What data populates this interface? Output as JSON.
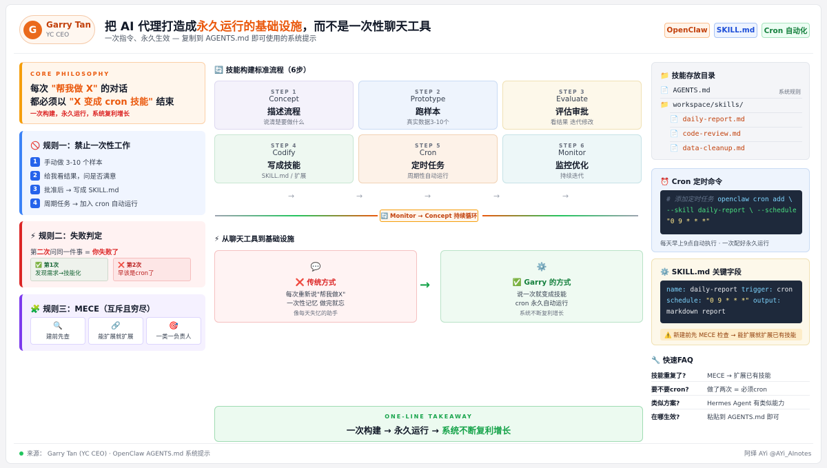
{
  "header": {
    "author": {
      "initial": "G",
      "name": "Garry Tan",
      "title": "YC CEO"
    },
    "headline_a": "把 AI 代理打造成",
    "headline_hl": "永久运行的基础设施",
    "headline_b": "，而不是一次性聊天工具",
    "subline": "一次指令、永久生效 — 复制到 AGENTS.md 即可使用的系统提示",
    "tags": [
      "OpenClaw",
      "SKILL.md",
      "Cron 自动化"
    ]
  },
  "philosophy": {
    "kicker": "CORE PHILOSOPHY",
    "l1_a": "每次 ",
    "l1_hl": "\"帮我做 X\"",
    "l1_b": " 的对话",
    "l2_a": "都必须以 ",
    "l2_hl": "\"X 变成 cron 技能\"",
    "l2_b": " 结束",
    "sub": "一次构建，永久运行，系统复利增长"
  },
  "rule1": {
    "icon": "🚫",
    "title": "规则一：禁止一次性工作",
    "steps": [
      {
        "n": "1",
        "text": "手动做 3-10 个样本"
      },
      {
        "n": "2",
        "text": "给我看结果，问是否满意"
      },
      {
        "n": "3",
        "text": "批准后 → 写成 SKILL.md"
      },
      {
        "n": "4",
        "text": "周期任务 → 加入 cron 自动运行"
      }
    ]
  },
  "rule2": {
    "icon": "⚡",
    "title": "规则二：失败判定",
    "desc_a": "第",
    "desc_hl": "二次",
    "desc_b": "问同一件事 = ",
    "desc_fail": "你失败了",
    "first_label": "✅ 第1次",
    "first_text": "发现需求→技能化",
    "second_label": "❌ 第2次",
    "second_text": "早该是cron了"
  },
  "rule3": {
    "icon": "🧩",
    "title": "规则三：MECE（互斥且穷尽）",
    "items": [
      {
        "icon": "🔍",
        "text": "建前先查"
      },
      {
        "icon": "🔗",
        "text": "能扩展就扩展"
      },
      {
        "icon": "🎯",
        "text": "一类一负责人"
      }
    ]
  },
  "flow": {
    "icon": "🔄",
    "title": "技能构建标准流程（6步）",
    "steps": [
      {
        "k": "STEP 1",
        "en": "Concept",
        "zh": "描述流程",
        "d": "说清楚要做什么"
      },
      {
        "k": "STEP 2",
        "en": "Prototype",
        "zh": "跑样本",
        "d": "真实数据3-10个"
      },
      {
        "k": "STEP 3",
        "en": "Evaluate",
        "zh": "评估审批",
        "d": "看结果 迭代修改"
      },
      {
        "k": "STEP 4",
        "en": "Codify",
        "zh": "写成技能",
        "d": "SKILL.md / 扩展"
      },
      {
        "k": "STEP 5",
        "en": "Cron",
        "zh": "定时任务",
        "d": "周期性自动运行"
      },
      {
        "k": "STEP 6",
        "en": "Monitor",
        "zh": "监控优化",
        "d": "持续迭代"
      }
    ],
    "arrow": "→",
    "loop": "🔄 Monitor → Concept 持续循环"
  },
  "compare": {
    "icon": "⚡",
    "title": "从聊天工具到基础设施",
    "old": {
      "icon": "💬",
      "title": "❌ 传统方式",
      "l1": "每次重新说\"帮我做X\"",
      "l2": "一次性记忆 做完就忘",
      "note": "像每天失忆的助手"
    },
    "new": {
      "icon": "⚙️",
      "title": "✅ Garry 的方式",
      "l1": "说一次就变成技能",
      "l2": "cron 永久自动运行",
      "note": "系统不断复利增长"
    },
    "arrow": "→"
  },
  "takeaway": {
    "kicker": "ONE-LINE TAKEAWAY",
    "a": "一次构建 → 永久运行 → ",
    "hl": "系统不断复利增长"
  },
  "directory": {
    "icon": "📁",
    "title": "技能存放目录",
    "root": {
      "icon": "📄",
      "name": "AGENTS.md",
      "note": "系统规则"
    },
    "folder": {
      "icon": "📁",
      "name": "workspace/skills/"
    },
    "files": [
      {
        "icon": "📄",
        "name": "daily-report.md"
      },
      {
        "icon": "📄",
        "name": "code-review.md"
      },
      {
        "icon": "📄",
        "name": "data-cleanup.md"
      }
    ]
  },
  "cron": {
    "icon": "⏰",
    "title": "Cron 定时命令",
    "comment": "# 添加定时任务",
    "cmd1": "openclaw cron add \\",
    "cmd2": "--skill daily-report \\ --schedule",
    "cmd3": "\"0 9 * * *\"",
    "note": "每天早上9点自动执行 · 一次配好永久运行"
  },
  "skill": {
    "icon": "⚙️",
    "title": "SKILL.md 关键字段",
    "k1": "name:",
    "v1": "daily-report",
    "k2": "trigger:",
    "v2": "cron",
    "k3": "schedule:",
    "v3": "\"0 9 * * *\"",
    "k4": "output:",
    "v4": "markdown report",
    "warn": "⚠️ 新建前先 MECE 检查 → 能扩展就扩展已有技能"
  },
  "faq": {
    "icon": "🔧",
    "title": "快速FAQ",
    "items": [
      {
        "q": "技能重复了?",
        "a": "MECE → 扩展已有技能"
      },
      {
        "q": "要不要cron?",
        "a": "做了两次 = 必须cron"
      },
      {
        "q": "类似方案?",
        "a": "Hermes Agent 有类似能力"
      },
      {
        "q": "在哪生效?",
        "a": "粘贴到 AGENTS.md 即可"
      }
    ]
  },
  "footer": {
    "left": "来源：  Garry Tan (YC CEO)  ·  OpenClaw AGENTS.md 系统提示",
    "right": "阿绎 AYi @AYi_AInotes"
  },
  "colors": {
    "accent": "#ea580c",
    "blue": "#2563eb",
    "green": "#16a34a",
    "red": "#dc2626",
    "purple": "#7c3aed"
  }
}
